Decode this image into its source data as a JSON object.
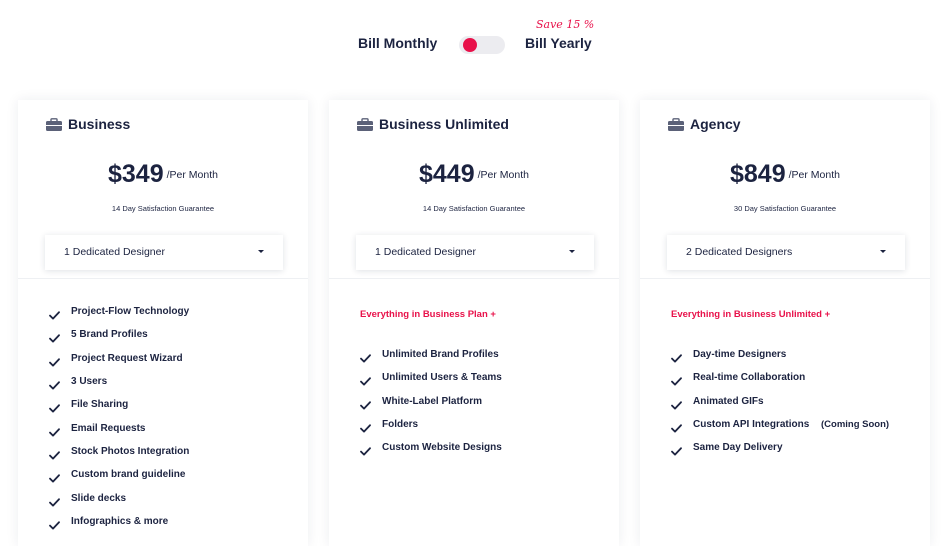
{
  "billing": {
    "monthly_label": "Bill Monthly",
    "yearly_label": "Bill Yearly",
    "save_note": "Save 15 %"
  },
  "colors": {
    "accent": "#e8114a",
    "text": "#1c2340",
    "muted_bg": "#ececf0"
  },
  "plans": [
    {
      "name": "Business",
      "price": "$349",
      "period": "/Per Month",
      "guarantee": "14 Day Satisfaction Guarantee",
      "designers": "1 Dedicated Designer",
      "tagline": "",
      "features": [
        "Project-Flow Technology",
        "5 Brand Profiles",
        "Project Request Wizard",
        "3 Users",
        "File Sharing",
        "Email Requests",
        "Stock Photos Integration",
        "Custom brand guideline",
        "Slide decks",
        "Infographics & more"
      ]
    },
    {
      "name": "Business Unlimited",
      "price": "$449",
      "period": "/Per Month",
      "guarantee": "14 Day Satisfaction Guarantee",
      "designers": "1 Dedicated Designer",
      "tagline": "Everything in Business Plan +",
      "features": [
        "Unlimited Brand Profiles",
        "Unlimited Users & Teams",
        "White-Label Platform",
        "Folders",
        "Custom Website Designs"
      ]
    },
    {
      "name": "Agency",
      "price": "$849",
      "period": "/Per Month",
      "guarantee": "30 Day Satisfaction Guarantee",
      "designers": "2 Dedicated Designers",
      "tagline": "Everything in Business Unlimited +",
      "features": [
        "Day-time Designers",
        "Real-time Collaboration",
        "Animated GIFs",
        "Custom API Integrations",
        "Same Day Delivery"
      ],
      "feature_note": "(Coming Soon)"
    }
  ]
}
